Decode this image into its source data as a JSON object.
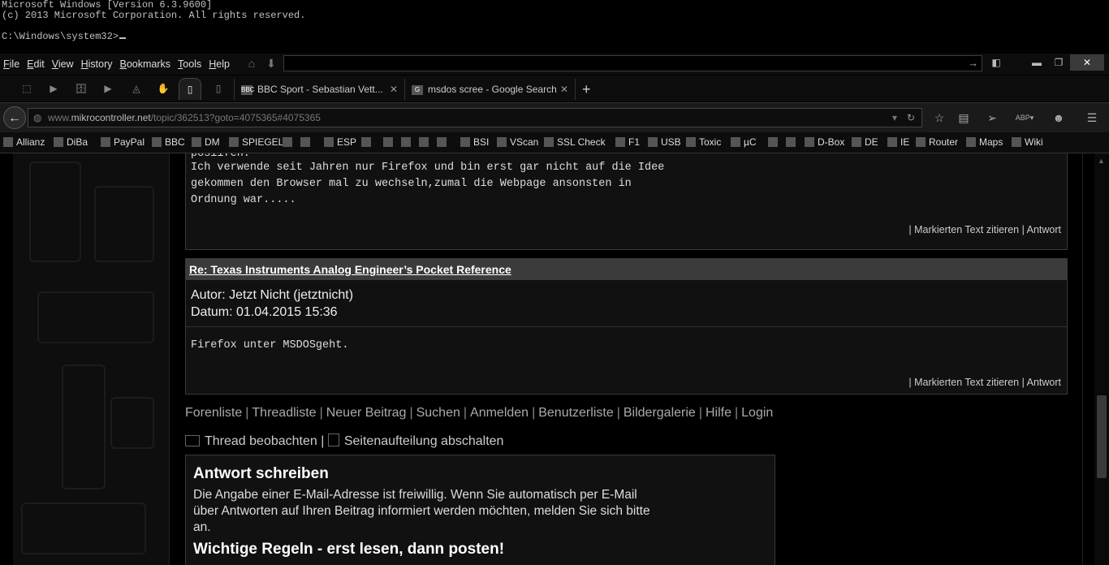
{
  "console": {
    "line1": "Microsoft Windows [Version 6.3.9600]",
    "line2": "(c) 2013 Microsoft Corporation. All rights reserved.",
    "prompt": "C:\\Windows\\system32>"
  },
  "menu": {
    "items": [
      "File",
      "Edit",
      "View",
      "History",
      "Bookmarks",
      "Tools",
      "Help"
    ]
  },
  "tabs": [
    {
      "label": "BBC Sport - Sebastian Vett...",
      "favicon": "BBC"
    },
    {
      "label": "msdos scree - Google Search",
      "favicon": "G"
    }
  ],
  "url": {
    "host_prefix": "www.",
    "host": "mikrocontroller.net",
    "path": "/topic/362513?goto=4075365#4075365"
  },
  "bookmarks": [
    "Allianz",
    "DiBa",
    "PayPal",
    "BBC",
    "DM",
    "SPIEGEL",
    "ESP",
    "BSI",
    "VScan",
    "SSL Check",
    "F1",
    "USB",
    "Toxic",
    "µC",
    "D-Box",
    "DE",
    "IE",
    "Router",
    "Maps",
    "Wiki"
  ],
  "post1": {
    "cut_line": "posiifen.",
    "line1": "Ich verwende seit Jahren nur Firefox und bin erst gar nicht auf die Idee",
    "line2": "gekommen den Browser mal zu wechseln,zumal die Webpage ansonsten in",
    "line3": "Ordnung war.....",
    "actions": "|  Markierten Text zitieren  |  Antwort"
  },
  "post2": {
    "subject": "Re: Texas Instruments Analog Engineer’s Pocket Reference",
    "author": "Autor: Jetzt Nicht (jetztnicht)",
    "date": "Datum: 01.04.2015 15:36",
    "body": "Firefox unter MSDOSgeht.",
    "actions": "|  Markierten Text zitieren  |  Antwort"
  },
  "forum_links": [
    "Forenliste",
    "Threadliste",
    "Neuer Beitrag",
    "Suchen",
    "Anmelden",
    "Benutzerliste",
    "Bildergalerie",
    "Hilfe",
    "Login"
  ],
  "thread_options": {
    "watch": "Thread beobachten",
    "separator": "|",
    "paging": "Seitenaufteilung abschalten"
  },
  "reply": {
    "title": "Antwort schreiben",
    "text": "Die Angabe einer E-Mail-Adresse ist freiwillig. Wenn Sie automatisch per E-Mail über Antworten auf Ihren Beitrag informiert werden möchten, melden Sie sich bitte an.",
    "rules": "Wichtige Regeln - erst lesen, dann posten!"
  }
}
